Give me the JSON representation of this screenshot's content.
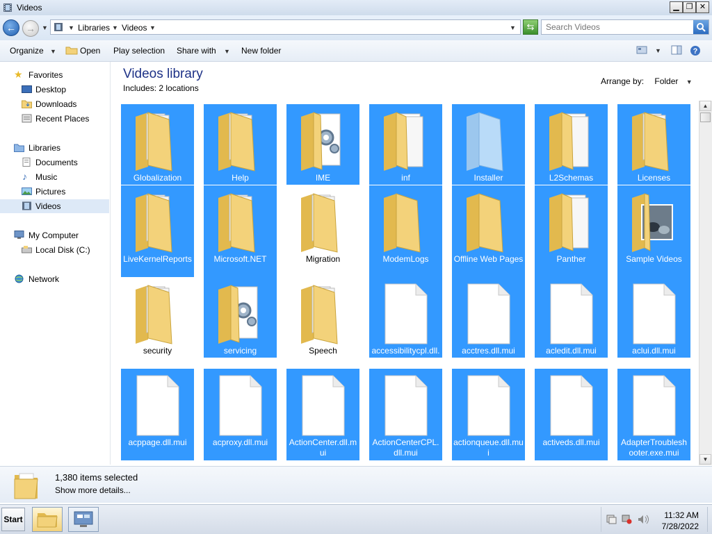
{
  "window": {
    "title": "Videos"
  },
  "address": {
    "crumbs": [
      "Libraries",
      "Videos"
    ],
    "search_placeholder": "Search Videos"
  },
  "toolbar": {
    "organize": "Organize",
    "open": "Open",
    "play_selection": "Play selection",
    "share_with": "Share with",
    "new_folder": "New folder"
  },
  "nav": {
    "favorites": {
      "label": "Favorites",
      "items": [
        "Desktop",
        "Downloads",
        "Recent Places"
      ]
    },
    "libraries": {
      "label": "Libraries",
      "items": [
        "Documents",
        "Music",
        "Pictures",
        "Videos"
      ],
      "selected": "Videos"
    },
    "computer": {
      "label": "My Computer",
      "items": [
        "Local Disk (C:)"
      ]
    },
    "network": {
      "label": "Network"
    }
  },
  "library": {
    "title": "Videos library",
    "includes": "Includes:  2 locations",
    "arrange_label": "Arrange by:",
    "arrange_value": "Folder"
  },
  "items": [
    {
      "name": "Globalization",
      "kind": "folder",
      "selected": true
    },
    {
      "name": "Help",
      "kind": "folder",
      "selected": true
    },
    {
      "name": "IME",
      "kind": "folder-gear",
      "selected": true
    },
    {
      "name": "inf",
      "kind": "folder-white",
      "selected": true
    },
    {
      "name": "Installer",
      "kind": "folder-ghost",
      "selected": true
    },
    {
      "name": "L2Schemas",
      "kind": "folder-white",
      "selected": true
    },
    {
      "name": "Licenses",
      "kind": "folder",
      "selected": true
    },
    {
      "name": "LiveKernelReports",
      "kind": "folder",
      "selected": true
    },
    {
      "name": "Microsoft.NET",
      "kind": "folder",
      "selected": true
    },
    {
      "name": "Migration",
      "kind": "folder",
      "selected": false
    },
    {
      "name": "ModemLogs",
      "kind": "folder-empty",
      "selected": true
    },
    {
      "name": "Offline Web Pages",
      "kind": "folder-empty",
      "selected": true
    },
    {
      "name": "Panther",
      "kind": "folder-white",
      "selected": true
    },
    {
      "name": "Sample Videos",
      "kind": "folder-photo",
      "selected": true
    },
    {
      "name": "security",
      "kind": "folder",
      "selected": false
    },
    {
      "name": "servicing",
      "kind": "folder-gear",
      "selected": true
    },
    {
      "name": "Speech",
      "kind": "folder",
      "selected": false
    },
    {
      "name": "accessibilitycpl.dll.mui",
      "kind": "file",
      "selected": true
    },
    {
      "name": "acctres.dll.mui",
      "kind": "file",
      "selected": true
    },
    {
      "name": "acledit.dll.mui",
      "kind": "file",
      "selected": true
    },
    {
      "name": "aclui.dll.mui",
      "kind": "file",
      "selected": true
    },
    {
      "name": "acppage.dll.mui",
      "kind": "file",
      "selected": true
    },
    {
      "name": "acproxy.dll.mui",
      "kind": "file",
      "selected": true
    },
    {
      "name": "ActionCenter.dll.mui",
      "kind": "file",
      "selected": true
    },
    {
      "name": "ActionCenterCPL.dll.mui",
      "kind": "file",
      "selected": true
    },
    {
      "name": "actionqueue.dll.mui",
      "kind": "file",
      "selected": true
    },
    {
      "name": "activeds.dll.mui",
      "kind": "file",
      "selected": true
    },
    {
      "name": "AdapterTroubleshooter.exe.mui",
      "kind": "file",
      "selected": true
    }
  ],
  "details": {
    "count": "1,380 items selected",
    "more": "Show more details..."
  },
  "taskbar": {
    "start": "Start",
    "time": "11:32 AM",
    "date": "7/28/2022"
  },
  "colors": {
    "selection": "#3399ff",
    "title": "#1e3287",
    "folder": "#f3d27a"
  }
}
